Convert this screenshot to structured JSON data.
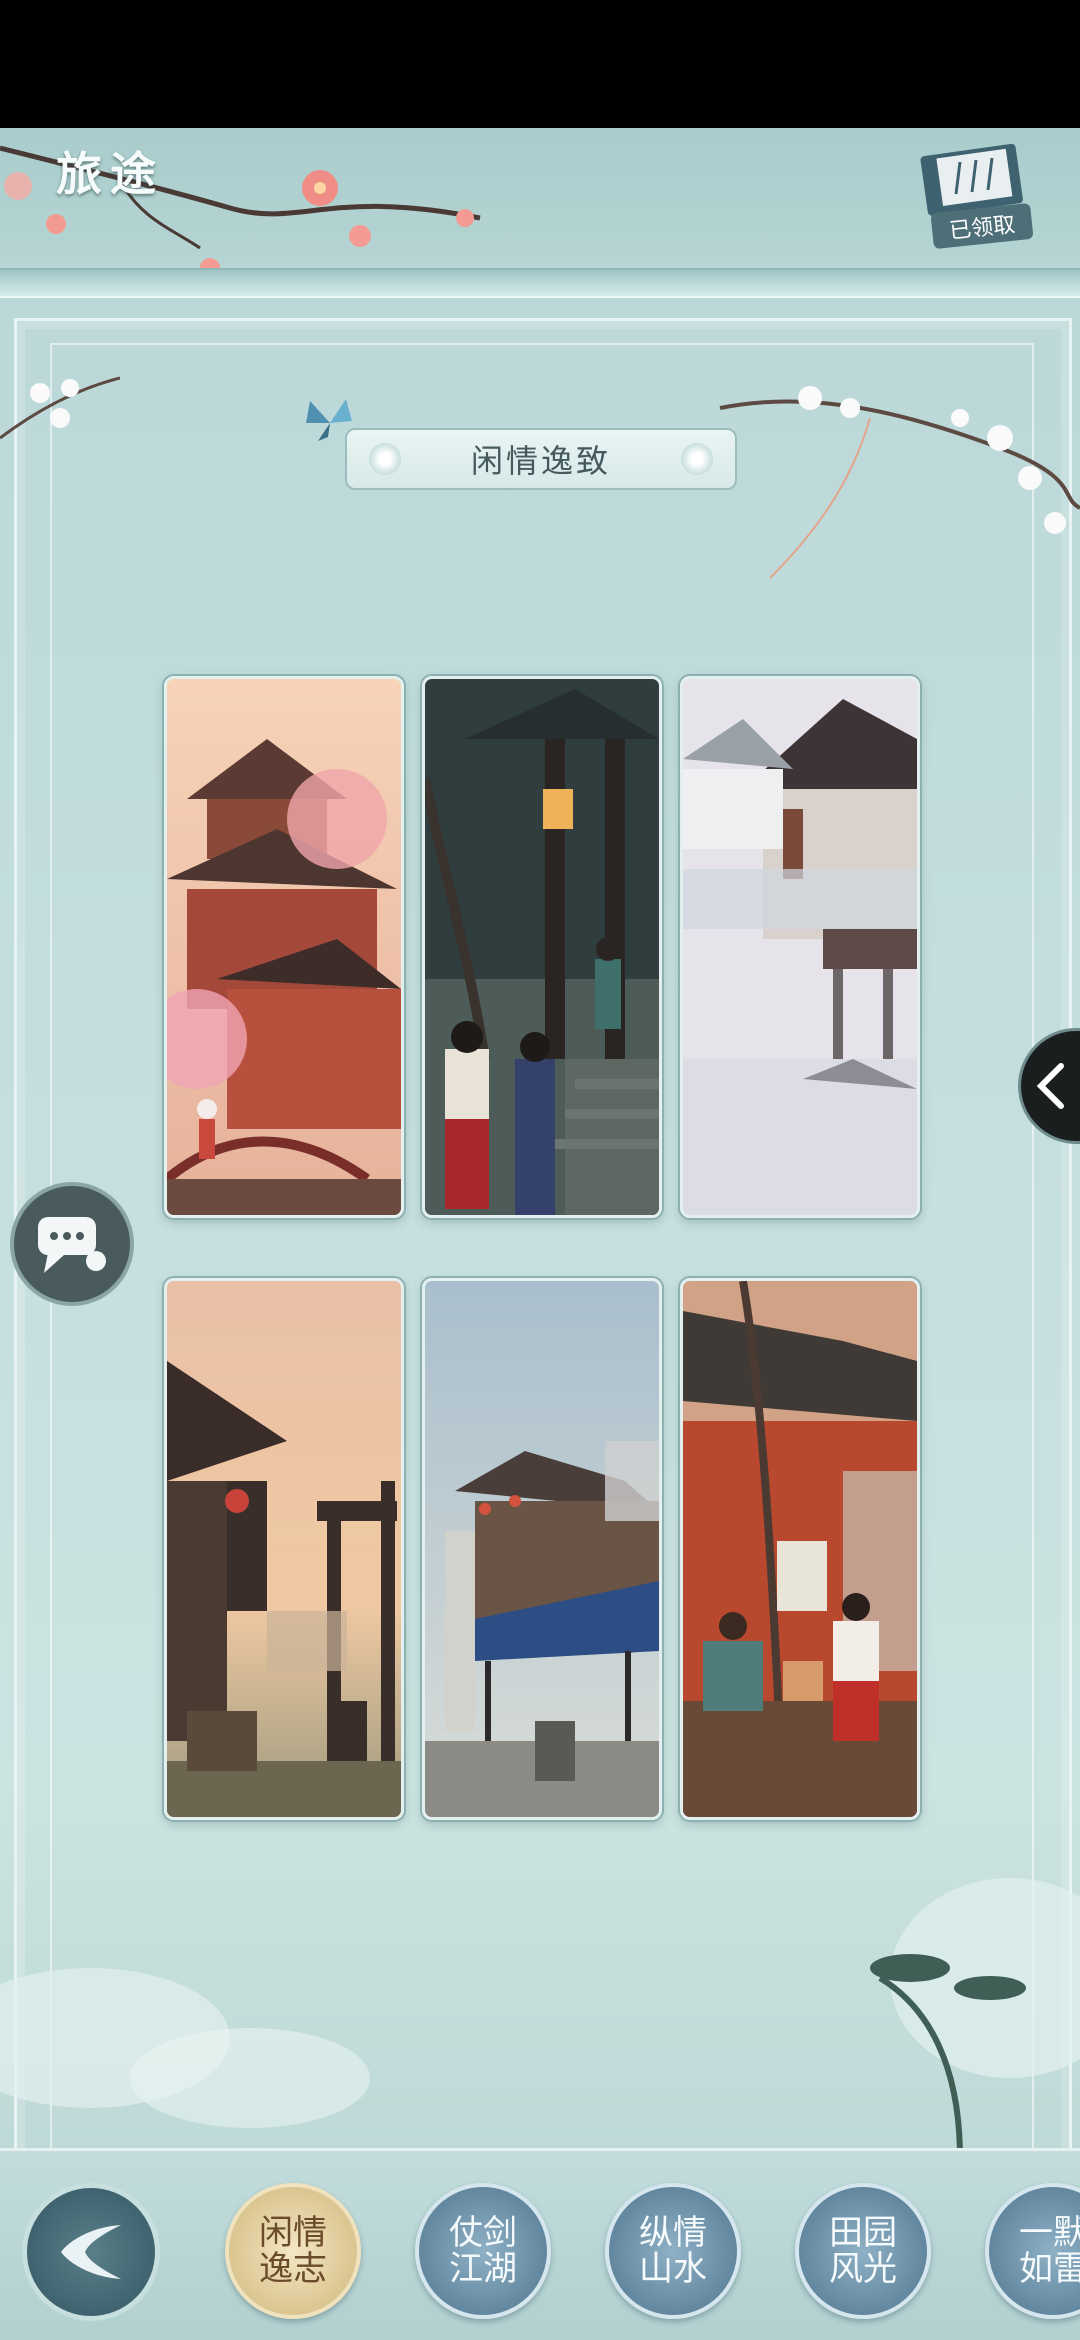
{
  "header": {
    "title": "旅途",
    "claim_label": "已领取"
  },
  "category": {
    "title": "闲情逸致"
  },
  "cards": [
    {
      "name": "pavilion-cherry"
    },
    {
      "name": "night-lantern-tower"
    },
    {
      "name": "misty-stilt-house"
    },
    {
      "name": "dusk-gate-street"
    },
    {
      "name": "market-awning"
    },
    {
      "name": "red-wall-vendor"
    }
  ],
  "bottom_tabs": [
    {
      "label": "闲情逸志",
      "active": true
    },
    {
      "label": "仗剑江湖",
      "active": false
    },
    {
      "label": "纵情山水",
      "active": false
    },
    {
      "label": "田园风光",
      "active": false
    },
    {
      "label": "一默如雷",
      "active": false
    }
  ],
  "colors": {
    "accent_active": "#d9c28d",
    "tab": "#5f849c",
    "frame": "#c4dede"
  }
}
